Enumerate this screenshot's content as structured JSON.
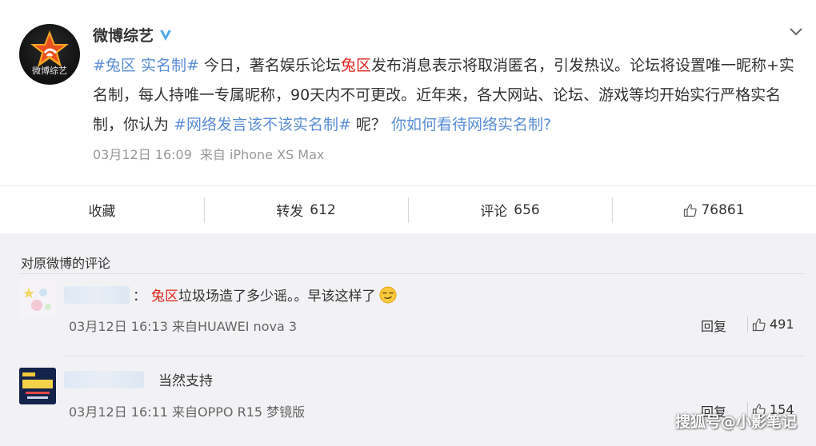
{
  "post": {
    "author": "微博综艺",
    "avatar_logo_text": "微博综艺",
    "verified_icon": "verified-badge-icon",
    "text": {
      "tag1": "#兔区 实名制#",
      "seg1": " 今日，著名娱乐论坛",
      "red1": "兔区",
      "seg2": "发布消息表示将取消匿名，引发热议。论坛将设置唯一昵称+实名制，每人持唯一专属昵称，90天内不可更改。近年来，各大网站、论坛、游戏等均开始实行严格实名制，你认为 ",
      "tag2": "#网络发言该不该实名制#",
      "seg3": " 呢？ ",
      "tag3": "你如何看待网络实名制?"
    },
    "time": "03月12日 16:09",
    "source": "来自 iPhone XS Max"
  },
  "actions": {
    "favorite": "收藏",
    "repost_label": "转发",
    "repost_count": "612",
    "comment_label": "评论",
    "comment_count": "656",
    "like_count": "76861"
  },
  "comments": {
    "title": "对原微博的评论",
    "items": [
      {
        "prefix": "：",
        "red": "兔区",
        "text": "垃圾场造了多少谣。。早该这样了",
        "emoji": "smirk-emoji-icon",
        "meta": "03月12日 16:13 来自HUAWEI nova 3",
        "reply": "回复",
        "likes": "491"
      },
      {
        "text": "当然支持",
        "meta": "03月12日 16:11 来自OPPO R15 梦镜版",
        "reply": "回复",
        "likes": "154"
      }
    ]
  },
  "watermark": "搜狐号@小影笔记",
  "colors": {
    "link": "#5b8dd6",
    "highlight": "#e2231a",
    "comments_bg": "#f2f2f5",
    "meta": "#999999"
  }
}
